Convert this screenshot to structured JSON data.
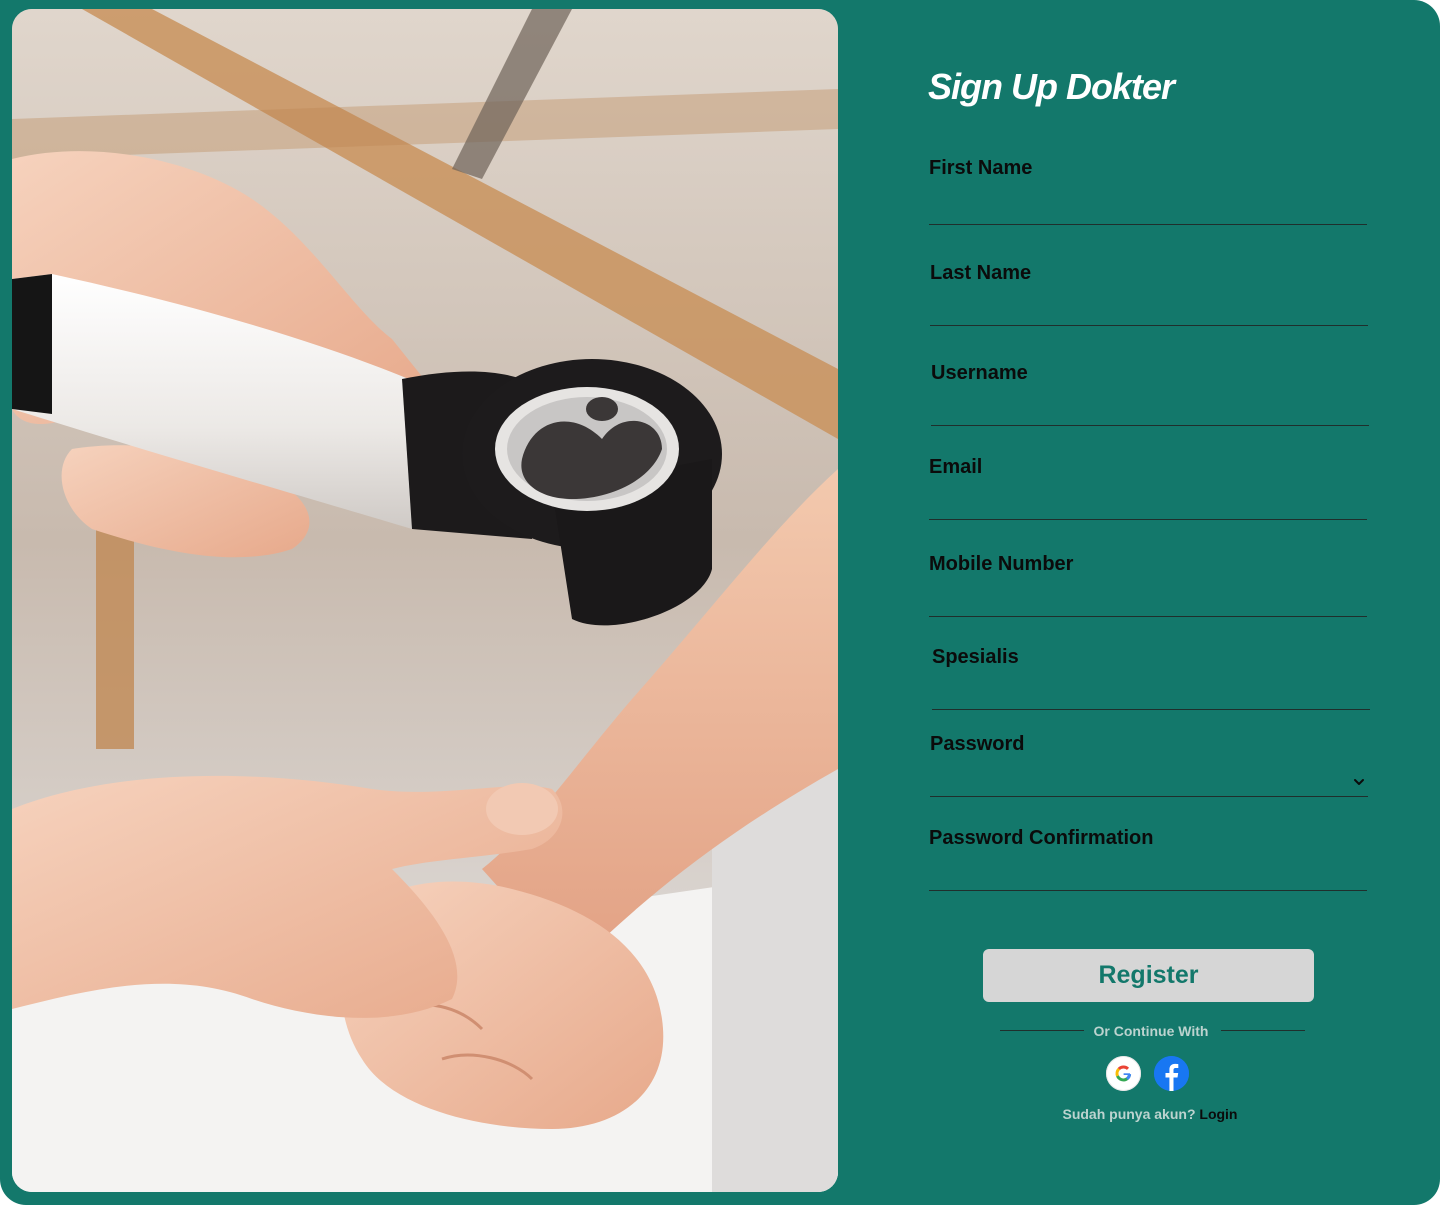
{
  "page": {
    "title": "Sign Up Dokter"
  },
  "form": {
    "fields": [
      {
        "label": "First Name",
        "value": ""
      },
      {
        "label": "Last Name",
        "value": ""
      },
      {
        "label": "Username",
        "value": ""
      },
      {
        "label": "Email",
        "value": ""
      },
      {
        "label": "Mobile Number",
        "value": ""
      },
      {
        "label": "Spesialis",
        "value": ""
      },
      {
        "label": "Password",
        "value": "",
        "icon": "chevron-down-icon"
      },
      {
        "label": "Password Confirmation",
        "value": ""
      }
    ],
    "register_label": "Register"
  },
  "social": {
    "divider_text": "Or Continue With",
    "providers": [
      {
        "name": "google",
        "icon": "google-icon"
      },
      {
        "name": "facebook",
        "icon": "facebook-icon"
      }
    ]
  },
  "footer": {
    "question": "Sudah punya akun?",
    "login_label": "Login"
  },
  "colors": {
    "brand": "#13786B",
    "button": "#D6D6D6",
    "muted_text": "#BCD3CF"
  }
}
